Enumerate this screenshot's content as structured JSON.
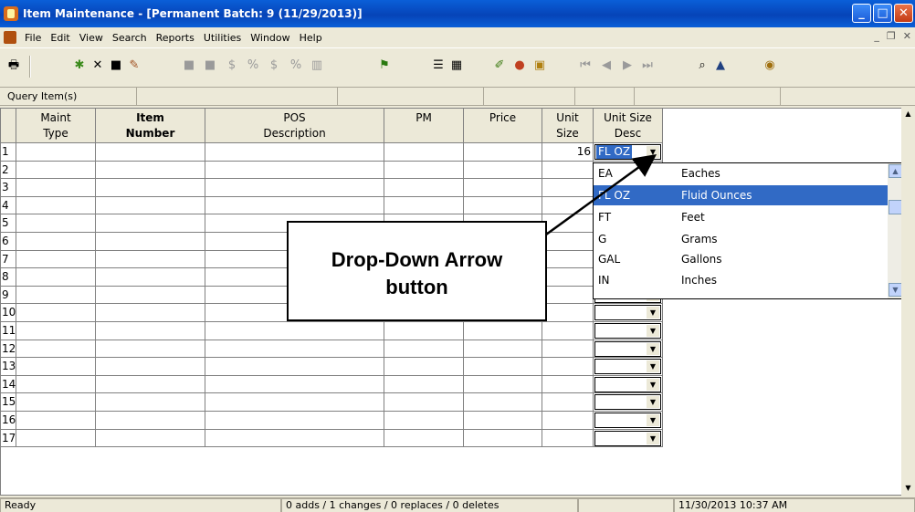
{
  "window": {
    "title": "Item Maintenance - [Permanent Batch: 9  (11/29/2013)]"
  },
  "menu": [
    "File",
    "Edit",
    "View",
    "Search",
    "Reports",
    "Utilities",
    "Window",
    "Help"
  ],
  "query": {
    "label": "Query Item(s)"
  },
  "columns": [
    {
      "l1": "",
      "l2": ""
    },
    {
      "l1": "Maint",
      "l2": "Type"
    },
    {
      "l1": "Item",
      "l2": "Number"
    },
    {
      "l1": "POS",
      "l2": "Description"
    },
    {
      "l1": "PM",
      "l2": ""
    },
    {
      "l1": "Price",
      "l2": ""
    },
    {
      "l1": "Unit",
      "l2": "Size"
    },
    {
      "l1": "Unit Size",
      "l2": "Desc"
    }
  ],
  "rows": [
    "1",
    "2",
    "3",
    "4",
    "5",
    "6",
    "7",
    "8",
    "9",
    "10",
    "11",
    "12",
    "13",
    "14",
    "15",
    "16",
    "17"
  ],
  "row1": {
    "unit_size": "16",
    "unit_desc": "FL OZ"
  },
  "dropdown_options": [
    {
      "code": "EA",
      "name": "Eaches"
    },
    {
      "code": "FL OZ",
      "name": "Fluid Ounces"
    },
    {
      "code": "FT",
      "name": "Feet"
    },
    {
      "code": "G",
      "name": "Grams"
    },
    {
      "code": "GAL",
      "name": "Gallons"
    },
    {
      "code": "IN",
      "name": "Inches"
    }
  ],
  "callout": {
    "line1": "Drop-Down Arrow",
    "line2": "button"
  },
  "status": {
    "ready": "Ready",
    "changes": "0 adds / 1 changes / 0 replaces / 0 deletes",
    "datetime": "11/30/2013 10:37 AM"
  }
}
